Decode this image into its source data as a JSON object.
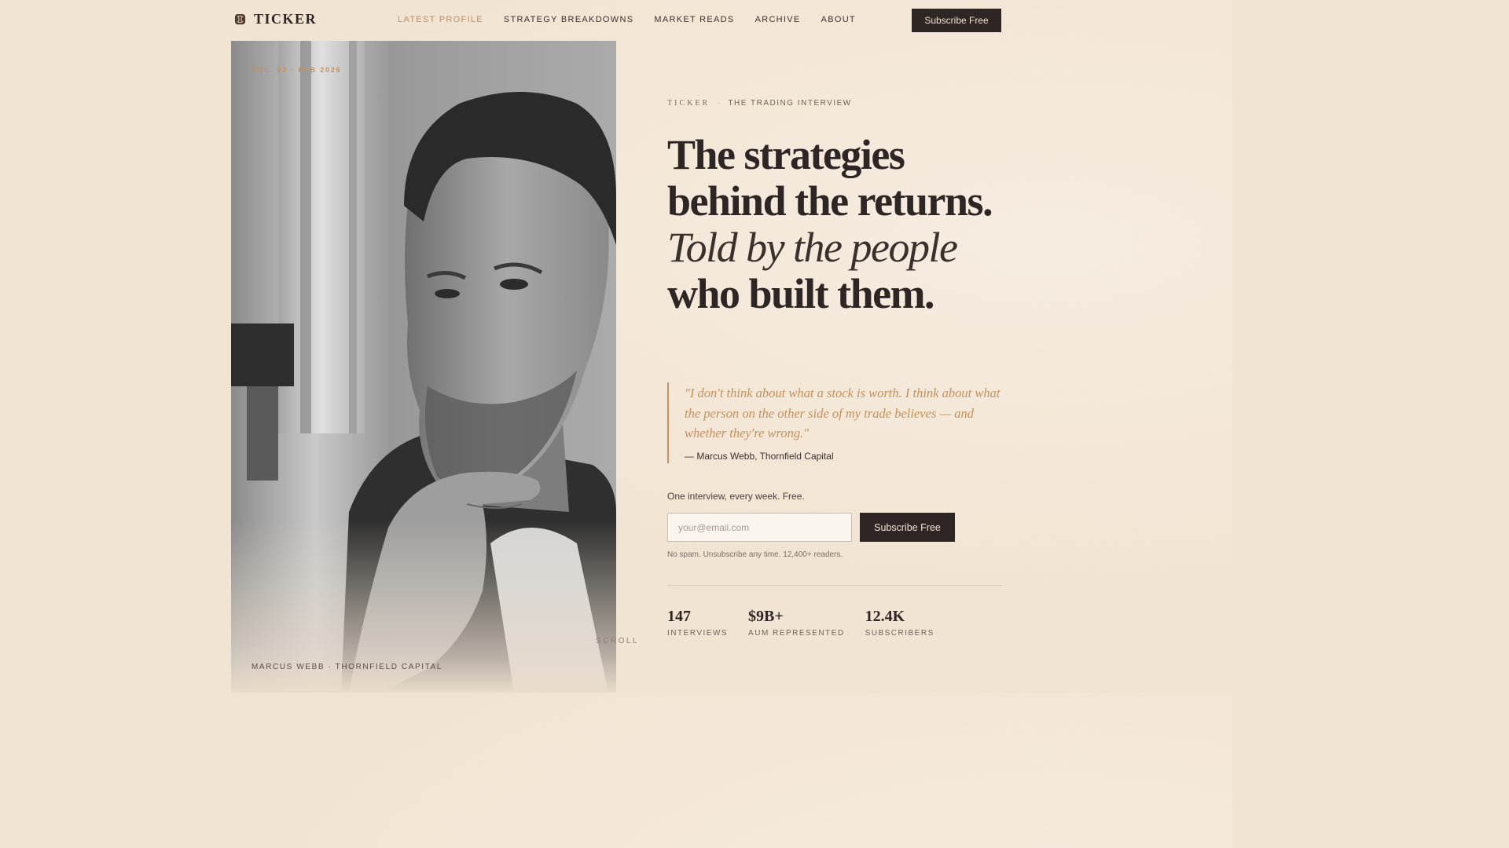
{
  "header": {
    "logo_text": "TICKER",
    "nav": [
      "LATEST PROFILE",
      "STRATEGY BREAKDOWNS",
      "MARKET READS",
      "ARCHIVE",
      "ABOUT"
    ],
    "active_nav": "LATEST PROFILE",
    "cta_label": "Subscribe Free"
  },
  "portrait": {
    "issue_label": "VOL. 03 · FEB 2026",
    "caption": "MARCUS WEBB · THORNFIELD CAPITAL",
    "scroll_label": "SCROLL"
  },
  "hero": {
    "eyebrow_brand": "TICKER",
    "eyebrow_separator": "·",
    "eyebrow_tag": "THE TRADING INTERVIEW",
    "headline_bold": "The strategies behind the returns.",
    "headline_italic": "Told by the people",
    "headline_end": "who built them.",
    "quote": "\"I don't think about what a stock is worth. I think about what the person on the other side of my trade believes — and whether they're wrong.\"",
    "quote_attribution": "— Marcus Webb, Thornfield Capital"
  },
  "signup": {
    "intro": "One interview, every week. Free.",
    "email_placeholder": "your@email.com",
    "button_label": "Subscribe Free",
    "fine_print": "No spam. Unsubscribe any time. 12,400+ readers."
  },
  "stats": [
    {
      "value": "147",
      "label": "INTERVIEWS"
    },
    {
      "value": "$9B+",
      "label": "AUM REPRESENTED"
    },
    {
      "value": "12.4K",
      "label": "SUBSCRIBERS"
    }
  ],
  "colors": {
    "background": "#f2e4d2",
    "ink": "#2e2624",
    "accent": "#c4915c",
    "nav_active": "#b98f6a"
  }
}
